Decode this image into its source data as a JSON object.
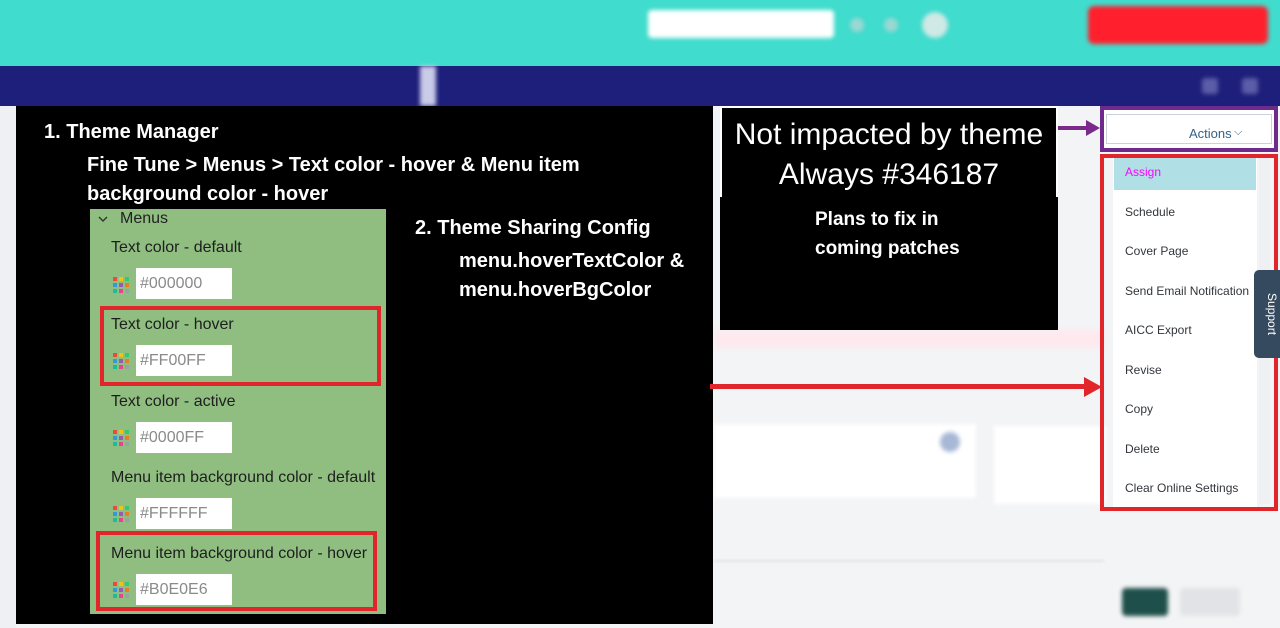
{
  "background_app": {
    "topbar": {
      "title": "",
      "user": "",
      "color": "#40dccd"
    },
    "navbar": {
      "label": "",
      "color": "#1e1f7a"
    }
  },
  "theme_manager": {
    "step1_title": "1.  Theme Manager",
    "step1_sub": "Fine Tune > Menus > Text color - hover & Menu item background color - hover",
    "section_label": "Menus",
    "fields": [
      {
        "label": "Text color - default",
        "value": "#000000",
        "highlighted": false
      },
      {
        "label": "Text color - hover",
        "value": "#FF00FF",
        "highlighted": true
      },
      {
        "label": "Text color - active",
        "value": "#0000FF",
        "highlighted": false
      },
      {
        "label": "Menu item background color - default",
        "value": "#FFFFFF",
        "highlighted": false
      },
      {
        "label": "Menu item background color - hover",
        "value": "#B0E0E6",
        "highlighted": true
      }
    ]
  },
  "theme_sharing": {
    "step2_title": "2. Theme Sharing Config",
    "step2_line1": "menu.hoverTextColor &",
    "step2_line2": "menu.hoverBgColor"
  },
  "note": {
    "line1": "Not impacted by theme",
    "line2": "Always #346187",
    "plans_line1": "Plans to fix in",
    "plans_line2": "coming patches"
  },
  "actions": {
    "label": "Actions",
    "chevron": "⌵",
    "color": "#346187"
  },
  "menu": {
    "items": [
      "Assign",
      "Schedule",
      "Cover Page",
      "Send Email Notification",
      "AICC Export",
      "Revise",
      "Copy",
      "Delete",
      "Clear Online Settings"
    ],
    "hover_text_color": "#FF00FF",
    "hover_bg_color": "#B0E0E6"
  },
  "support_tab": {
    "label": "Support"
  },
  "colors": {
    "highlight_red": "#e0252b",
    "purple": "#6f2b8c",
    "panel_green": "#8fbe80"
  }
}
